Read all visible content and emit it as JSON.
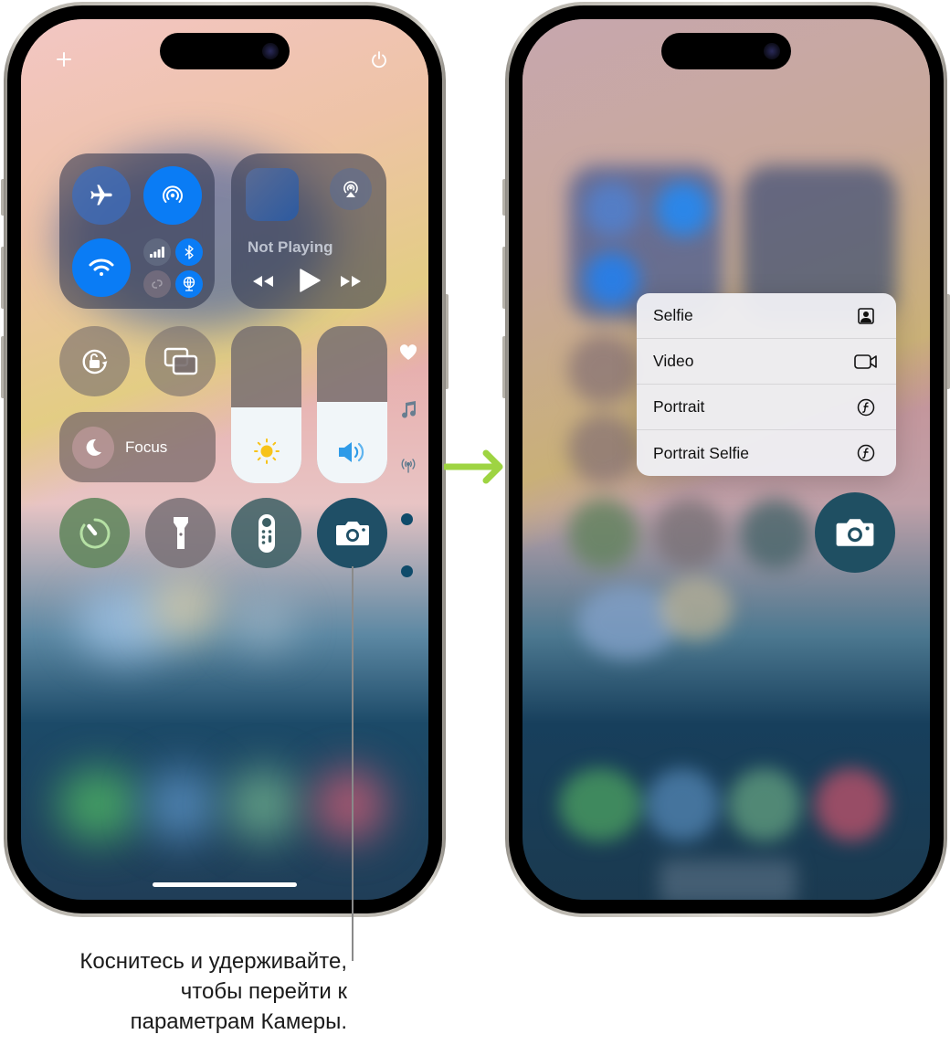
{
  "left_phone": {
    "top_bar": {
      "add_icon": "plus-icon",
      "power_icon": "power-icon"
    },
    "connectivity": {
      "airplane": {
        "icon": "airplane-icon",
        "active": false
      },
      "airdrop": {
        "icon": "airdrop-icon",
        "active": true
      },
      "wifi": {
        "icon": "wifi-icon",
        "active": true
      },
      "cellular": {
        "icon": "cellular-signal-icon",
        "active": false
      },
      "bluetooth": {
        "icon": "bluetooth-icon",
        "active": true
      },
      "hotspot": {
        "icon": "personal-hotspot-icon",
        "active": false
      },
      "vpn": {
        "icon": "vpn-network-icon",
        "active": true
      }
    },
    "now_playing": {
      "status": "Not Playing",
      "airplay_icon": "airplay-icon",
      "controls": [
        "rewind-icon",
        "play-icon",
        "fast-forward-icon"
      ]
    },
    "toggles": {
      "orientation_lock": "orientation-lock-icon",
      "screen_mirroring": "screen-mirroring-icon",
      "focus_label": "Focus",
      "focus_icon": "moon-icon"
    },
    "sliders": {
      "brightness": {
        "icon": "sun-icon",
        "level_percent": 48
      },
      "volume": {
        "icon": "speaker-icon",
        "level_percent": 52
      }
    },
    "page_indicators": [
      "heart-icon",
      "music-note-icon",
      "antenna-icon",
      "page-dot",
      "page-dot"
    ],
    "bottom_row": [
      "timer-icon",
      "flashlight-icon",
      "remote-icon",
      "camera-icon"
    ]
  },
  "arrow_color": "#9ed442",
  "right_phone": {
    "camera_menu": [
      {
        "label": "Selfie",
        "icon": "selfie-portrait-icon"
      },
      {
        "label": "Video",
        "icon": "video-camera-icon"
      },
      {
        "label": "Portrait",
        "icon": "aperture-f-icon"
      },
      {
        "label": "Portrait Selfie",
        "icon": "aperture-f-icon"
      }
    ],
    "camera_button_icon": "camera-icon"
  },
  "caption": {
    "lines": [
      "Коснитесь и удерживайте,",
      "чтобы перейти к",
      "параметрам Камеры."
    ]
  }
}
